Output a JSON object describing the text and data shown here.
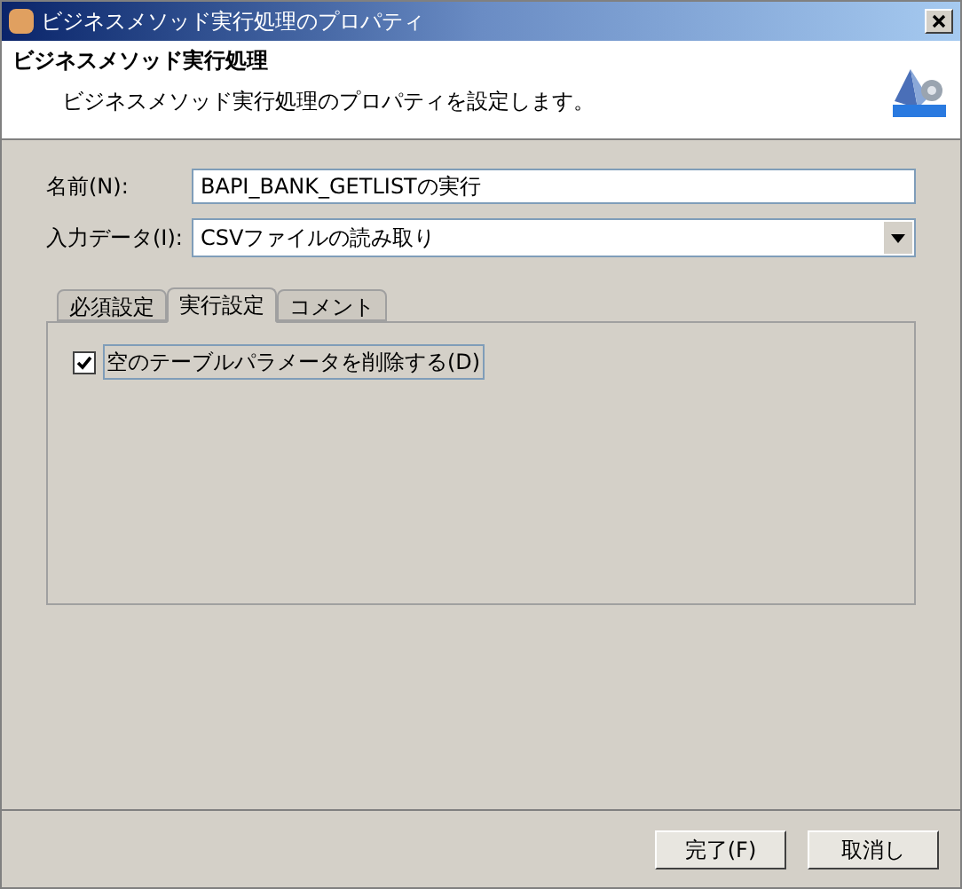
{
  "window": {
    "title": "ビジネスメソッド実行処理のプロパティ"
  },
  "header": {
    "title": "ビジネスメソッド実行処理",
    "description": "ビジネスメソッド実行処理のプロパティを設定します。"
  },
  "fields": [
    {
      "kind": "text",
      "label": "名前(N):",
      "value": "BAPI_BANK_GETLISTの実行"
    },
    {
      "kind": "dropdown",
      "label": "入力データ(I):",
      "value": "CSVファイルの読み取り"
    }
  ],
  "tabs": [
    {
      "label": "必須設定",
      "selected": false
    },
    {
      "label": "実行設定",
      "selected": true
    },
    {
      "label": "コメント",
      "selected": false
    }
  ],
  "options": [
    {
      "label": "空のテーブルパラメータを削除する(D)",
      "checked": true
    }
  ],
  "buttons": [
    "完了(F)",
    "取消し"
  ]
}
